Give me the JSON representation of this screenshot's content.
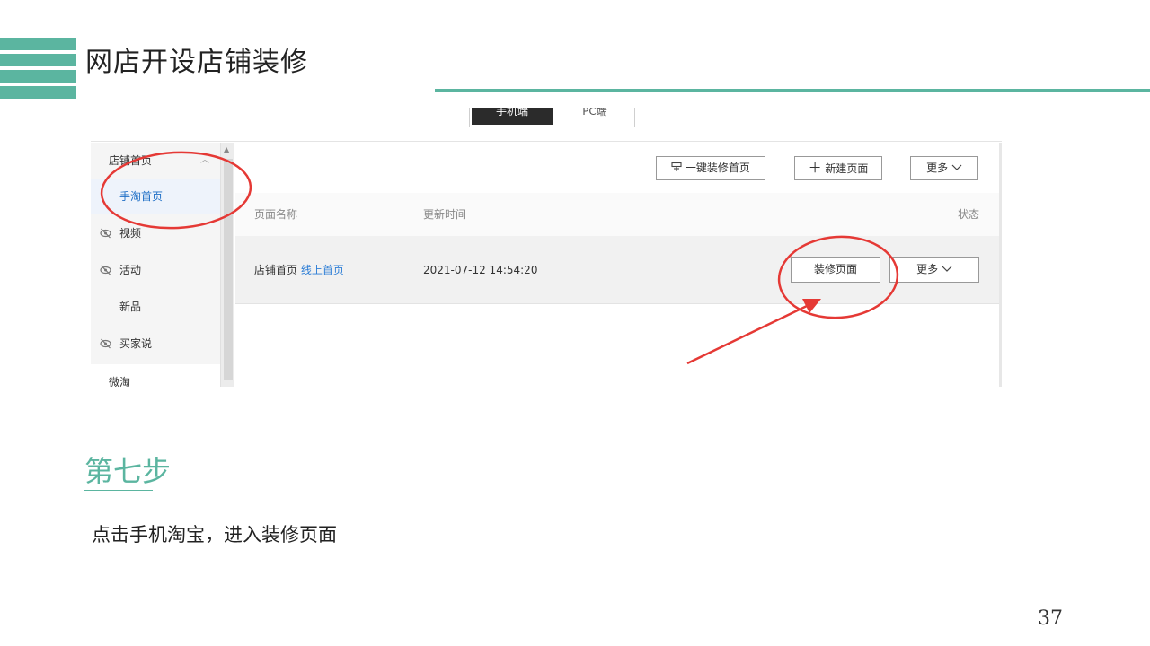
{
  "slide": {
    "title": "网店开设店铺装修",
    "step_title": "第七步",
    "step_description": "点击手机淘宝，进入装修页面",
    "page_number": "37",
    "accent_color": "#5bb5a0"
  },
  "screenshot": {
    "device_toggle": {
      "mobile": "手机端",
      "pc": "PC端"
    },
    "sidebar": {
      "group_label": "店铺首页",
      "items": [
        {
          "label": "手淘首页",
          "icon": "",
          "active": true
        },
        {
          "label": "视频",
          "icon": "hidden-eye-icon"
        },
        {
          "label": "活动",
          "icon": "hidden-eye-icon"
        },
        {
          "label": "新品",
          "icon": ""
        },
        {
          "label": "买家说",
          "icon": "hidden-eye-icon"
        }
      ],
      "bottom_label": "微淘"
    },
    "toolbar": {
      "one_click": "一键装修首页",
      "new_page": "新建页面",
      "more": "更多"
    },
    "table": {
      "headers": {
        "name": "页面名称",
        "updated": "更新时间",
        "status": "状态"
      },
      "rows": [
        {
          "name": "店铺首页",
          "tag": "线上首页",
          "updated": "2021-07-12 14:54:20",
          "decorate": "装修页面",
          "more": "更多"
        }
      ]
    }
  }
}
